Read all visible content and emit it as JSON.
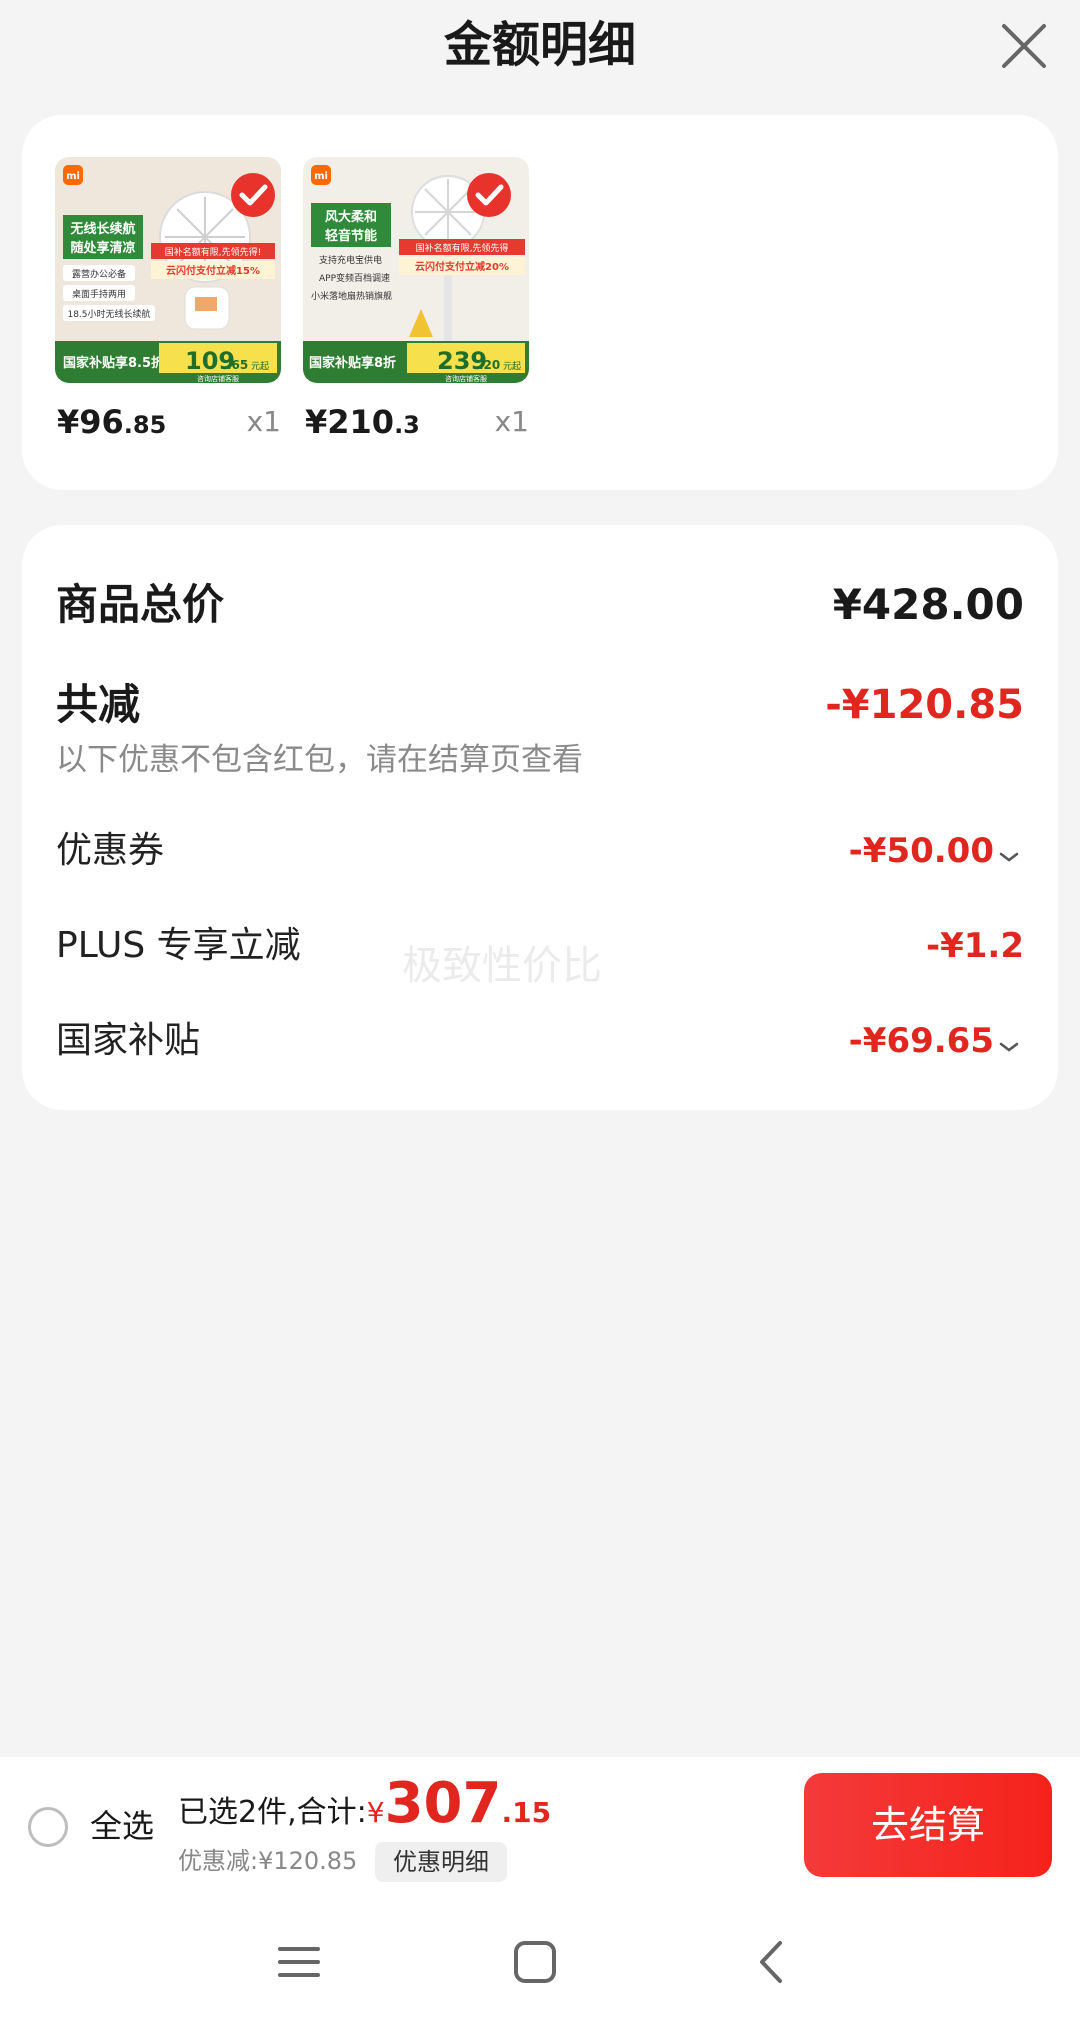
{
  "header": {
    "title": "金额明细"
  },
  "products": [
    {
      "price_main": "¥96",
      "price_dec": ".85",
      "qty": "x1",
      "image": {
        "headline_1": "无线长续航",
        "headline_2": "随处享清凉",
        "banner": "国补名额有限,先领先得!",
        "promo": "云闪付支付立减15%",
        "features": [
          "露营办公必备",
          "桌面手持两用",
          "18.5小时无线长续航"
        ],
        "bottom_left": "国家补贴享8.5折",
        "bottom_price_main": "109",
        "bottom_price_dec": ".65",
        "bottom_unit": "元起",
        "bottom_note": "咨询店铺客服"
      }
    },
    {
      "price_main": "¥210",
      "price_dec": ".3",
      "qty": "x1",
      "image": {
        "headline_1": "风大柔和",
        "headline_2": "轻音节能",
        "banner": "国补名额有限,先领先得",
        "promo": "云闪付支付立减20%",
        "features": [
          "支持充电宝供电",
          "APP变频百档调速",
          "小米落地扇热销旗舰"
        ],
        "bottom_left": "国家补贴享8折",
        "bottom_price_main": "239",
        "bottom_price_dec": ".20",
        "bottom_unit": "元起",
        "bottom_note": "咨询店铺客服"
      }
    }
  ],
  "summary": {
    "total_label": "商品总价",
    "total_value": "¥428.00",
    "reduce_label": "共减",
    "reduce_value": "-¥120.85",
    "note": "以下优惠不包含红包，请在结算页查看",
    "items": [
      {
        "label": "优惠券",
        "value": "-¥50.00",
        "has_chevron": true
      },
      {
        "label": "PLUS 专享立减",
        "value": "-¥1.2",
        "has_chevron": false
      },
      {
        "label": "国家补贴",
        "value": "-¥69.65",
        "has_chevron": true
      }
    ],
    "watermark": "极致性价比"
  },
  "bottom": {
    "select_all": "全选",
    "selected_text": "已选2件,合计:",
    "currency": "¥",
    "total_main": "307",
    "total_dec": ".15",
    "discount_text": "优惠减:¥120.85",
    "discount_detail": "优惠明细",
    "checkout": "去结算"
  },
  "colors": {
    "accent": "#e0261f",
    "checkout_bg": "#f5221b"
  }
}
